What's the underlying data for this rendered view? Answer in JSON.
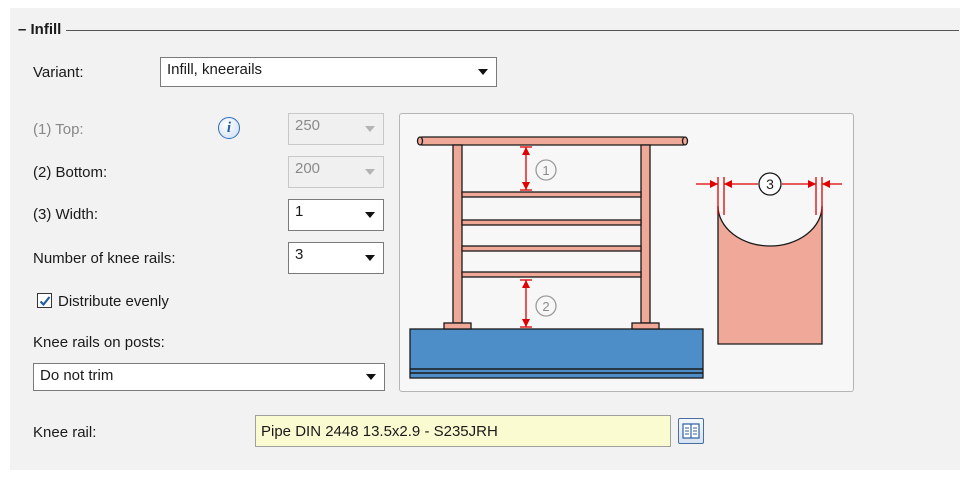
{
  "group": {
    "title": "Infill",
    "collapse_symbol": "–"
  },
  "variant": {
    "label": "Variant:",
    "value": "Infill, kneerails"
  },
  "top": {
    "label": "(1) Top:",
    "value": "250"
  },
  "bottom": {
    "label": "(2) Bottom:",
    "value": "200"
  },
  "width": {
    "label": "(3) Width:",
    "value": "1"
  },
  "knee_rail_count": {
    "label": "Number of knee rails:",
    "value": "3"
  },
  "distribute": {
    "label": "Distribute evenly",
    "checked": true
  },
  "knee_rails_on_posts": {
    "label": "Knee rails on posts:",
    "value": "Do not trim"
  },
  "knee_rail": {
    "label": "Knee rail:",
    "value": "Pipe DIN 2448 13.5x2.9 - S235JRH"
  },
  "diagram": {
    "marker_1": "1",
    "marker_2": "2",
    "marker_3": "3"
  },
  "icons": {
    "info": "info-icon",
    "library": "library-icon",
    "dropdown": "chevron-down-icon",
    "check": "checkmark-icon"
  },
  "colors": {
    "rail": "#f0a898",
    "base": "#4d8ec9",
    "dimension": "#e00000",
    "group_bg": "#f2f2f2",
    "text_field": "#fbfbd2"
  }
}
